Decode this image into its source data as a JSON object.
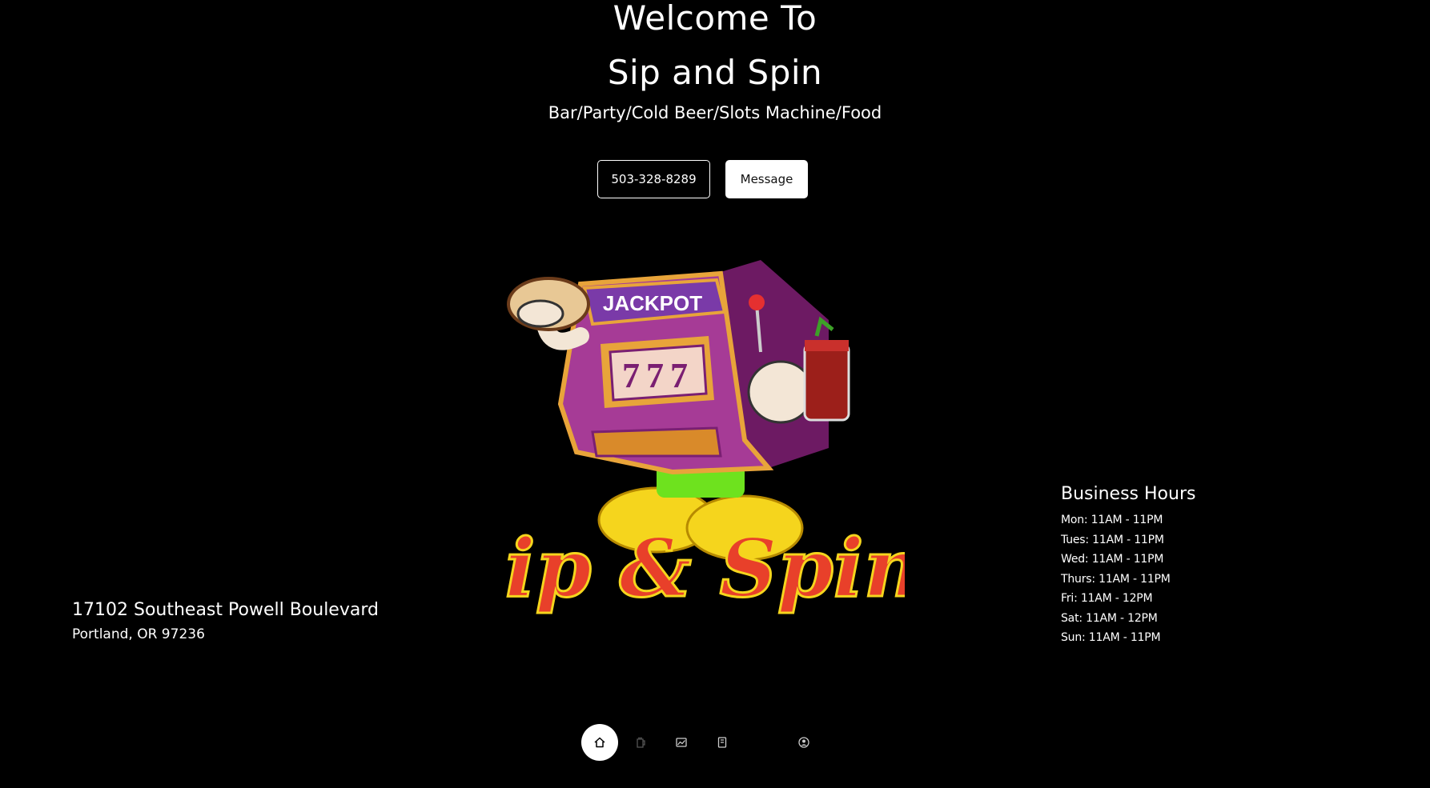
{
  "hero": {
    "title_line1": "Welcome To",
    "title_line2": "Sip and Spin",
    "tagline": "Bar/Party/Cold Beer/Slots Machine/Food"
  },
  "actions": {
    "phone_label": "503-328-8289",
    "message_label": "Message"
  },
  "logo": {
    "marquee_text": "JACKPOT",
    "reels_text": "777",
    "wordmark": "Sip & Spin"
  },
  "address": {
    "street": "17102 Southeast Powell Boulevard",
    "city": "Portland, OR 97236"
  },
  "hours": {
    "heading": "Business Hours",
    "days": [
      "Mon: 11AM - 11PM",
      "Tues: 11AM - 11PM",
      "Wed: 11AM - 11PM",
      "Thurs: 11AM - 11PM",
      "Fri: 11AM - 12PM",
      "Sat: 11AM - 12PM",
      "Sun: 11AM - 11PM"
    ]
  },
  "nav": {
    "items": [
      {
        "icon": "home-icon",
        "active": true
      },
      {
        "icon": "beer-icon",
        "active": false
      },
      {
        "icon": "chart-image-icon",
        "active": false
      },
      {
        "icon": "menu-book-icon",
        "active": false
      },
      {
        "icon": "user-circle-icon",
        "active": false
      }
    ]
  },
  "colors": {
    "background": "#000000",
    "text": "#ffffff",
    "slot_purple": "#7a1f72",
    "slot_orange": "#e8a43a",
    "shoe_yellow": "#f5d51d",
    "wordmark_red": "#e8402a"
  }
}
